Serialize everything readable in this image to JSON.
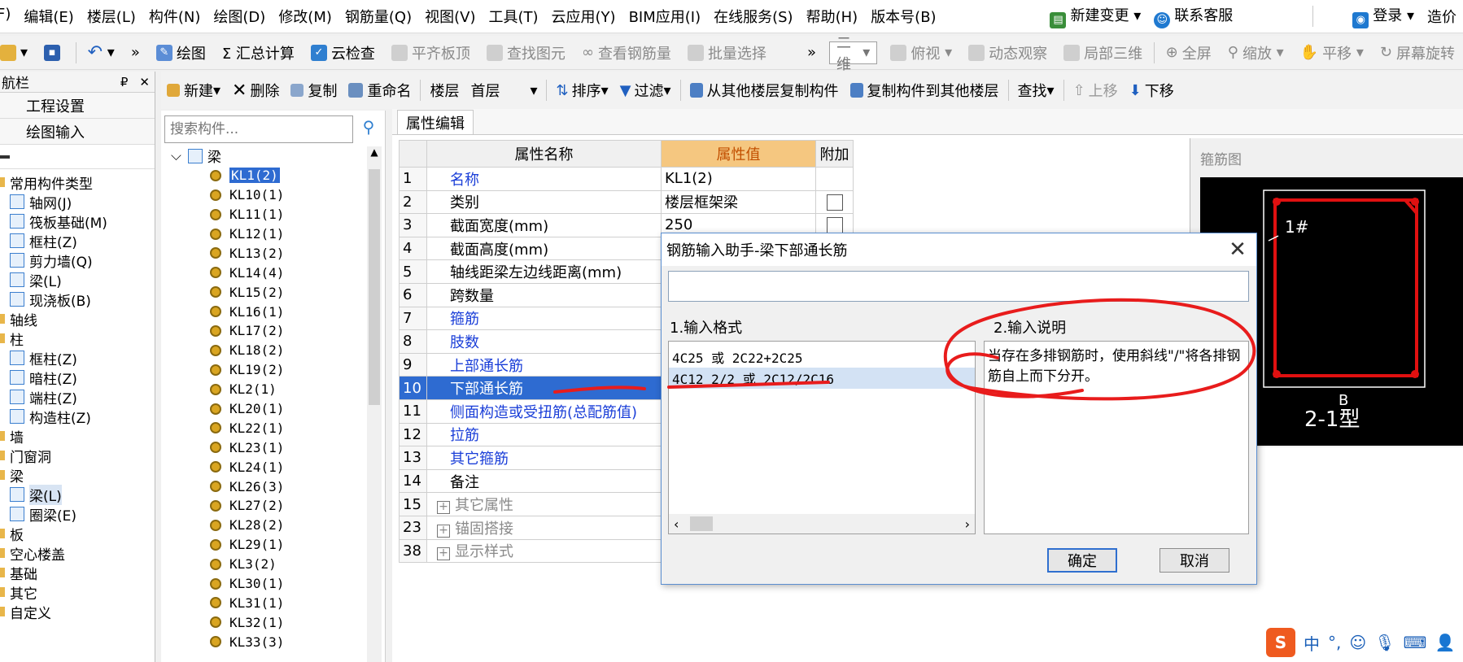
{
  "menu": [
    "F)",
    "编辑(E)",
    "楼层(L)",
    "构件(N)",
    "绘图(D)",
    "修改(M)",
    "钢筋量(Q)",
    "视图(V)",
    "工具(T)",
    "云应用(Y)",
    "BIM应用(I)",
    "在线服务(S)",
    "帮助(H)",
    "版本号(B)"
  ],
  "menu_right": {
    "new_change": "新建变更",
    "contact": "联系客服",
    "login": "登录",
    "cost": "造价"
  },
  "toolbar1": {
    "draw": "绘图",
    "sum": "Σ 汇总计算",
    "cloud_check": "云检查",
    "align_slab": "平齐板顶",
    "find_elem": "查找图元",
    "view_rebar": "查看钢筋量",
    "batch_select": "批量选择",
    "view_mode": "二维",
    "top_view": "俯视",
    "dynamic_view": "动态观察",
    "local_3d": "局部三维",
    "fullscreen": "全屏",
    "zoom": "缩放",
    "pan": "平移",
    "rotate": "屏幕旋转"
  },
  "nav": {
    "title": "航栏",
    "pin": "ᵖ",
    "close": "✕",
    "project_settings": "工程设置",
    "draw_input": "绘图输入",
    "items": [
      {
        "label": "常用构件类型",
        "level": 0
      },
      {
        "label": "轴网(J)",
        "level": 1
      },
      {
        "label": "筏板基础(M)",
        "level": 1
      },
      {
        "label": "框柱(Z)",
        "level": 1
      },
      {
        "label": "剪力墙(Q)",
        "level": 1
      },
      {
        "label": "梁(L)",
        "level": 1
      },
      {
        "label": "现浇板(B)",
        "level": 1
      },
      {
        "label": "轴线",
        "level": 0
      },
      {
        "label": "柱",
        "level": 0
      },
      {
        "label": "框柱(Z)",
        "level": 1
      },
      {
        "label": "暗柱(Z)",
        "level": 1
      },
      {
        "label": "端柱(Z)",
        "level": 1
      },
      {
        "label": "构造柱(Z)",
        "level": 1
      },
      {
        "label": "墙",
        "level": 0
      },
      {
        "label": "门窗洞",
        "level": 0
      },
      {
        "label": "梁",
        "level": 0
      },
      {
        "label": "梁(L)",
        "level": 1,
        "selected": true
      },
      {
        "label": "圈梁(E)",
        "level": 1
      },
      {
        "label": "板",
        "level": 0
      },
      {
        "label": "空心楼盖",
        "level": 0
      },
      {
        "label": "基础",
        "level": 0
      },
      {
        "label": "其它",
        "level": 0
      },
      {
        "label": "自定义",
        "level": 0
      }
    ]
  },
  "toolbar2": {
    "new": "新建",
    "delete": "删除",
    "copy": "复制",
    "rename": "重命名",
    "floor_label": "楼层",
    "floor_value": "首层",
    "sort": "排序",
    "filter": "过滤",
    "copy_from": "从其他楼层复制构件",
    "copy_to": "复制构件到其他楼层",
    "find": "查找",
    "move_up": "上移",
    "move_down": "下移"
  },
  "list": {
    "search_placeholder": "搜索构件...",
    "root": "梁",
    "items": [
      "KL1(2)",
      "KL10(1)",
      "KL11(1)",
      "KL12(1)",
      "KL13(2)",
      "KL14(4)",
      "KL15(2)",
      "KL16(1)",
      "KL17(2)",
      "KL18(2)",
      "KL19(2)",
      "KL2(1)",
      "KL20(1)",
      "KL22(1)",
      "KL23(1)",
      "KL24(1)",
      "KL26(3)",
      "KL27(2)",
      "KL28(2)",
      "KL29(1)",
      "KL3(2)",
      "KL30(1)",
      "KL31(1)",
      "KL32(1)",
      "KL33(3)"
    ]
  },
  "props": {
    "tab": "属性编辑",
    "col_name": "属性名称",
    "col_value": "属性值",
    "col_extra": "附加",
    "rows": [
      {
        "num": "1",
        "name": "名称",
        "value": "KL1(2)",
        "style": "blue",
        "chk": false
      },
      {
        "num": "2",
        "name": "类别",
        "value": "楼层框架梁",
        "style": "",
        "chk": true
      },
      {
        "num": "3",
        "name": "截面宽度(mm)",
        "value": "250",
        "style": "",
        "chk": true
      },
      {
        "num": "4",
        "name": "截面高度(mm)",
        "value": "",
        "style": "",
        "chk": false
      },
      {
        "num": "5",
        "name": "轴线距梁左边线距离(mm)",
        "value": "",
        "style": "",
        "chk": false
      },
      {
        "num": "6",
        "name": "跨数量",
        "value": "",
        "style": "",
        "chk": false
      },
      {
        "num": "7",
        "name": "箍筋",
        "value": "",
        "style": "blue",
        "chk": false
      },
      {
        "num": "8",
        "name": "肢数",
        "value": "",
        "style": "blue",
        "chk": false
      },
      {
        "num": "9",
        "name": "上部通长筋",
        "value": "",
        "style": "blue",
        "chk": false
      },
      {
        "num": "10",
        "name": "下部通长筋",
        "value": "",
        "style": "blue",
        "chk": false,
        "selected": true
      },
      {
        "num": "11",
        "name": "侧面构造或受扭筋(总配筋值)",
        "value": "",
        "style": "blue",
        "chk": false
      },
      {
        "num": "12",
        "name": "拉筋",
        "value": "",
        "style": "blue",
        "chk": false
      },
      {
        "num": "13",
        "name": "其它箍筋",
        "value": "",
        "style": "blue",
        "chk": false
      },
      {
        "num": "14",
        "name": "备注",
        "value": "",
        "style": "",
        "chk": false
      },
      {
        "num": "15",
        "name": "其它属性",
        "value": "",
        "style": "grey",
        "group": true
      },
      {
        "num": "23",
        "name": "锚固搭接",
        "value": "",
        "style": "grey",
        "group": true
      },
      {
        "num": "38",
        "name": "显示样式",
        "value": "",
        "style": "grey",
        "group": true
      }
    ]
  },
  "stirrup": {
    "title": "箍筋图",
    "label_1": "1#",
    "label_b": "B",
    "type_label": "2-1型",
    "frame_color": "#e01010"
  },
  "dialog": {
    "title": "钢筋输入助手-梁下部通长筋",
    "input_value": "",
    "format_label": "1.输入格式",
    "desc_label": "2.输入说明",
    "formats": [
      "4C25 或 2C22+2C25",
      "4C12 2/2 或 2C12/2C16"
    ],
    "desc": "当存在多排钢筋时，使用斜线\"/\"将各排钢筋自上而下分开。",
    "ok": "确定",
    "cancel": "取消"
  },
  "ime": {
    "brand": "S",
    "lang": "中",
    "punct": "°,"
  },
  "colors": {
    "accent": "#2e6bd1",
    "annotation": "#e81c1c",
    "value_header": "#f5c780"
  }
}
